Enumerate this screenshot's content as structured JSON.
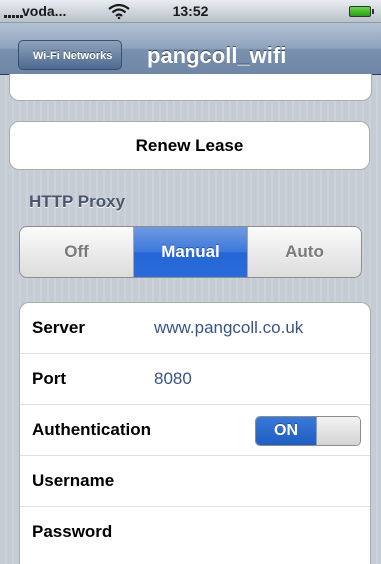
{
  "status_bar": {
    "carrier": "voda...",
    "time": "13:52",
    "icons": [
      "signal-bars-icon",
      "wifi-icon",
      "battery-icon"
    ]
  },
  "nav": {
    "back_label": "Wi-Fi Networks",
    "title": "pangcoll_wifi"
  },
  "renew_lease": {
    "label": "Renew Lease"
  },
  "http_proxy": {
    "section_title": "HTTP Proxy",
    "options": [
      "Off",
      "Manual",
      "Auto"
    ],
    "selected": "Manual"
  },
  "proxy_settings": {
    "server": {
      "label": "Server",
      "value": "www.pangcoll.co.uk"
    },
    "port": {
      "label": "Port",
      "value": "8080"
    },
    "authentication": {
      "label": "Authentication",
      "state": "ON"
    },
    "username": {
      "label": "Username",
      "value": ""
    },
    "password": {
      "label": "Password",
      "value": ""
    }
  },
  "colors": {
    "selected_blue": "#2a6bd9",
    "value_text": "#385487",
    "nav_bar": "#7990ae",
    "background": "#c5ccd4"
  }
}
